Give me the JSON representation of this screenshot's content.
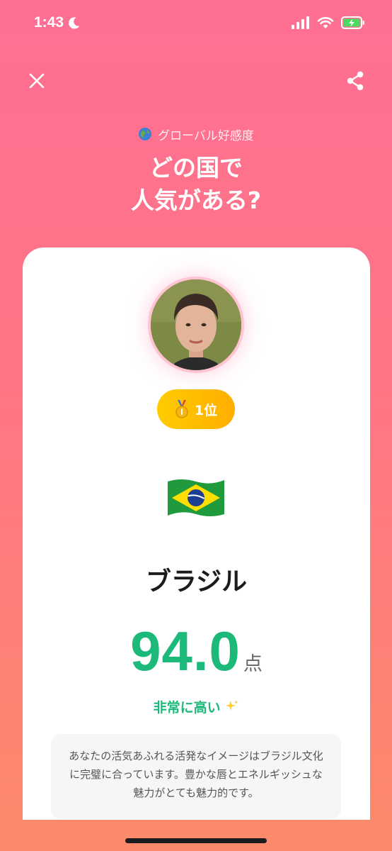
{
  "status": {
    "time": "1:43"
  },
  "header": {
    "section_label": "グローバル好感度",
    "title_line1": "どの国で",
    "title_line2": "人気がある?"
  },
  "result": {
    "rank_label": "1位",
    "country": "ブラジル",
    "score": "94.0",
    "score_unit": "点",
    "level": "非常に高い",
    "description": "あなたの活気あふれる活発なイメージはブラジル文化に完璧に合っています。豊かな唇とエネルギッシュな魅力がとても魅力的です。"
  },
  "colors": {
    "accent_green": "#1db97a",
    "badge_gold": "#ffbe00",
    "bg_top": "#ff6f93",
    "bg_bottom": "#fb8a6b"
  },
  "icons": [
    "moon-icon",
    "signal-icon",
    "wifi-icon",
    "battery-icon",
    "close-icon",
    "share-icon",
    "globe-icon",
    "medal-icon",
    "brazil-flag-icon",
    "sparkles-icon"
  ]
}
